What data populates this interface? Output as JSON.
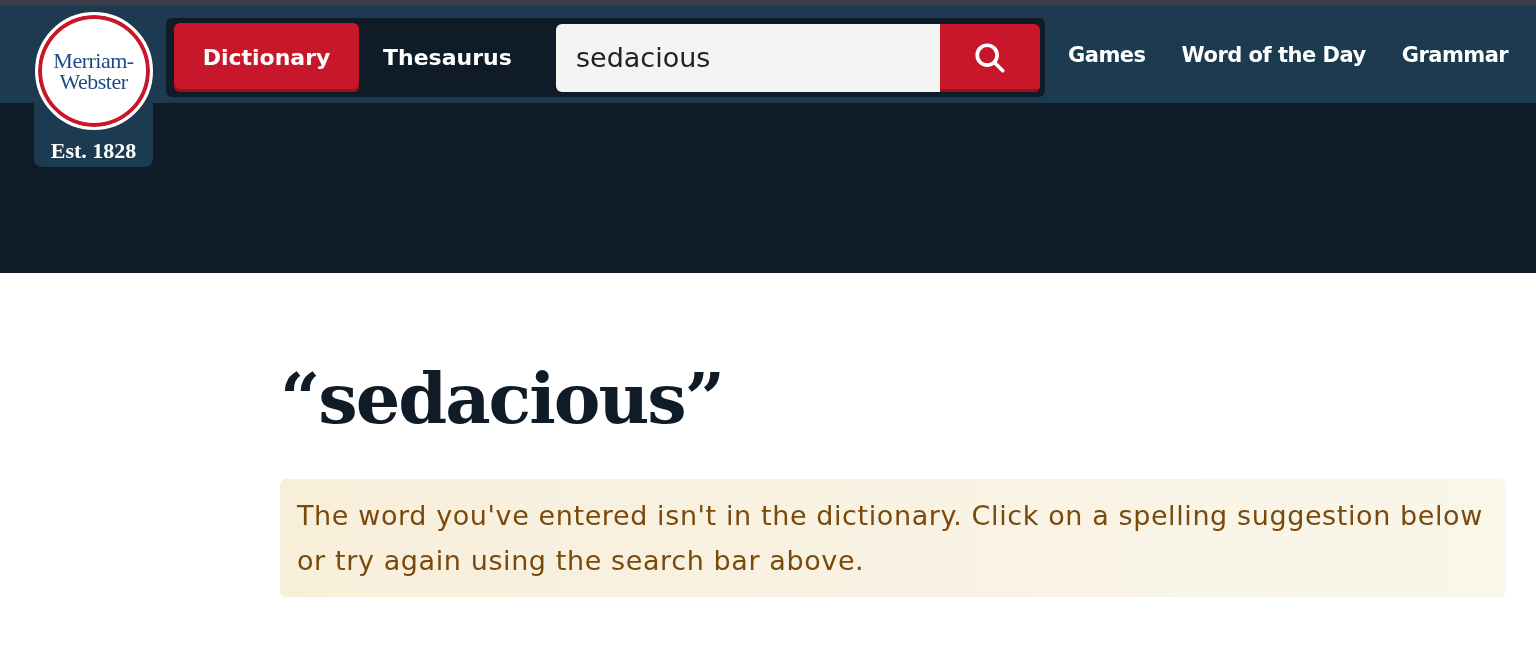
{
  "logo": {
    "lines": [
      "Merriam-",
      "Webster"
    ],
    "established": "Est. 1828"
  },
  "search_tabs": [
    {
      "label": "Dictionary",
      "selected": true
    },
    {
      "label": "Thesaurus",
      "selected": false
    }
  ],
  "search": {
    "value": "sedacious"
  },
  "nav_links": [
    "Games",
    "Word of the Day",
    "Grammar"
  ],
  "heading": "“sedacious”",
  "notice": "The word you've entered isn't in the dictionary. Click on a spelling suggestion below or try again using the search bar above."
}
